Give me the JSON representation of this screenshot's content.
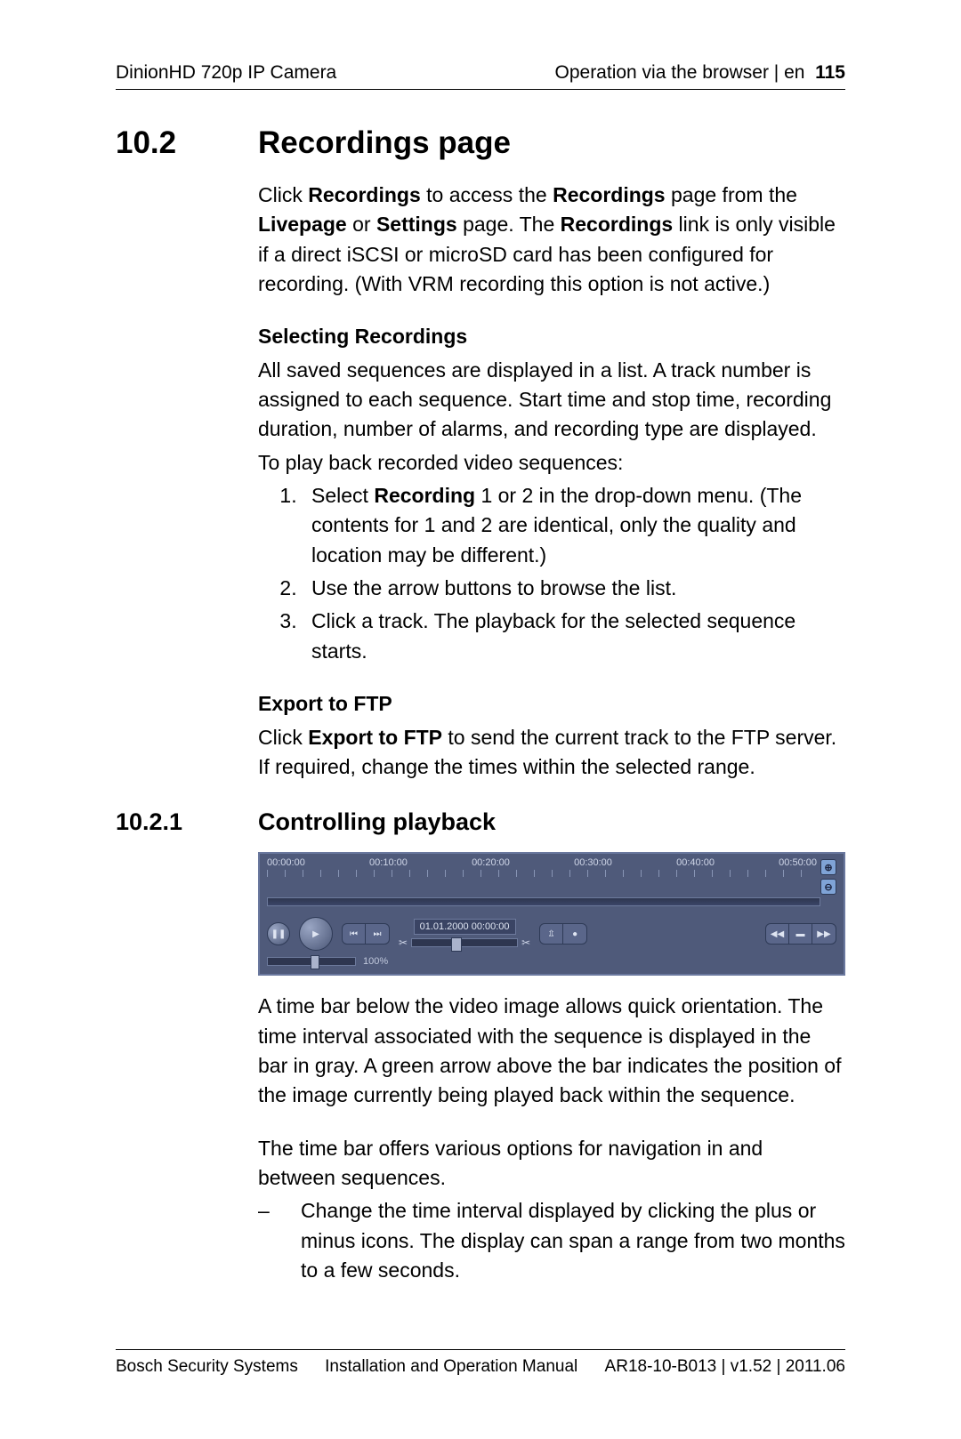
{
  "header": {
    "left": "DinionHD 720p IP Camera",
    "right_text": "Operation via the browser | en",
    "page_no": "115"
  },
  "s1": {
    "num": "10.2",
    "title": "Recordings page",
    "intro_parts": {
      "a": "Click ",
      "b": "Recordings",
      "c": " to access the ",
      "d": "Recordings",
      "e": " page from the ",
      "f": "Livepage",
      "g": " or ",
      "h": "Settings",
      "i": " page. The ",
      "j": "Recordings",
      "k": " link is only visible if a direct iSCSI or microSD card has been configured for recording. (With VRM recording this option is not active.)"
    },
    "sub_sel": "Selecting Recordings",
    "sel_p": "All saved sequences are displayed in a list. A track number is assigned to each sequence. Start time and stop time, recording duration, number of alarms, and recording type are displayed.",
    "sel_p2": "To play back recorded video sequences:",
    "li1_a": "Select ",
    "li1_b": "Recording",
    "li1_c": " 1 or 2 in the drop-down menu. (The contents for 1 and 2 are identical, only the quality and location may be different.)",
    "li2": "Use the arrow buttons to browse the list.",
    "li3": "Click a track. The playback for the selected sequence starts.",
    "sub_ftp": "Export to FTP",
    "ftp_a": "Click ",
    "ftp_b": "Export to FTP",
    "ftp_c": " to send the current track to the FTP server. If required, change the times within the selected range."
  },
  "s2": {
    "num": "10.2.1",
    "title": "Controlling playback",
    "panel": {
      "ticks": [
        "00:00:00",
        "00:10:00",
        "00:20:00",
        "00:30:00",
        "00:40:00",
        "00:50:00"
      ],
      "timestamp": "01.01.2000 00:00:00",
      "volume": "100%"
    },
    "p1": "A time bar below the video image allows quick orientation. The time interval associated with the sequence is displayed in the bar in gray. A green arrow above the bar indicates the position of the image currently being played back within the sequence.",
    "p2": "The time bar offers various options for navigation in and between sequences.",
    "dash": "–",
    "b1": "Change the time interval displayed by clicking the plus or minus icons. The display can span a range from two months to a few seconds."
  },
  "footer": {
    "left": "Bosch Security Systems",
    "center": "Installation and Operation Manual",
    "right": "AR18-10-B013 | v1.52 | 2011.06"
  }
}
